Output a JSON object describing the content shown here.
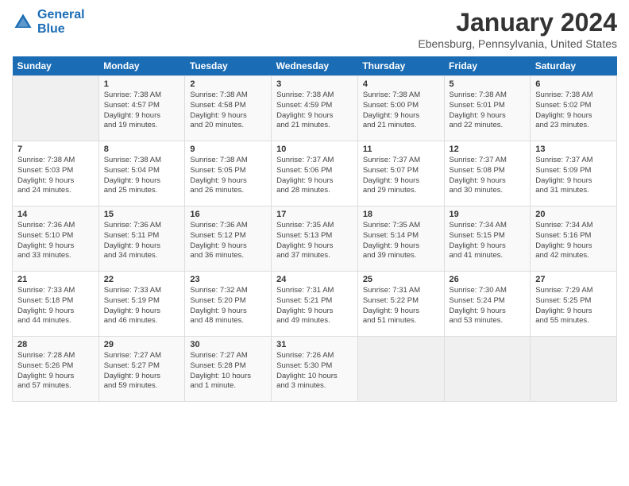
{
  "logo": {
    "line1": "General",
    "line2": "Blue"
  },
  "title": "January 2024",
  "location": "Ebensburg, Pennsylvania, United States",
  "headers": [
    "Sunday",
    "Monday",
    "Tuesday",
    "Wednesday",
    "Thursday",
    "Friday",
    "Saturday"
  ],
  "weeks": [
    [
      {
        "day": "",
        "info": ""
      },
      {
        "day": "1",
        "info": "Sunrise: 7:38 AM\nSunset: 4:57 PM\nDaylight: 9 hours\nand 19 minutes."
      },
      {
        "day": "2",
        "info": "Sunrise: 7:38 AM\nSunset: 4:58 PM\nDaylight: 9 hours\nand 20 minutes."
      },
      {
        "day": "3",
        "info": "Sunrise: 7:38 AM\nSunset: 4:59 PM\nDaylight: 9 hours\nand 21 minutes."
      },
      {
        "day": "4",
        "info": "Sunrise: 7:38 AM\nSunset: 5:00 PM\nDaylight: 9 hours\nand 21 minutes."
      },
      {
        "day": "5",
        "info": "Sunrise: 7:38 AM\nSunset: 5:01 PM\nDaylight: 9 hours\nand 22 minutes."
      },
      {
        "day": "6",
        "info": "Sunrise: 7:38 AM\nSunset: 5:02 PM\nDaylight: 9 hours\nand 23 minutes."
      }
    ],
    [
      {
        "day": "7",
        "info": "Sunrise: 7:38 AM\nSunset: 5:03 PM\nDaylight: 9 hours\nand 24 minutes."
      },
      {
        "day": "8",
        "info": "Sunrise: 7:38 AM\nSunset: 5:04 PM\nDaylight: 9 hours\nand 25 minutes."
      },
      {
        "day": "9",
        "info": "Sunrise: 7:38 AM\nSunset: 5:05 PM\nDaylight: 9 hours\nand 26 minutes."
      },
      {
        "day": "10",
        "info": "Sunrise: 7:37 AM\nSunset: 5:06 PM\nDaylight: 9 hours\nand 28 minutes."
      },
      {
        "day": "11",
        "info": "Sunrise: 7:37 AM\nSunset: 5:07 PM\nDaylight: 9 hours\nand 29 minutes."
      },
      {
        "day": "12",
        "info": "Sunrise: 7:37 AM\nSunset: 5:08 PM\nDaylight: 9 hours\nand 30 minutes."
      },
      {
        "day": "13",
        "info": "Sunrise: 7:37 AM\nSunset: 5:09 PM\nDaylight: 9 hours\nand 31 minutes."
      }
    ],
    [
      {
        "day": "14",
        "info": "Sunrise: 7:36 AM\nSunset: 5:10 PM\nDaylight: 9 hours\nand 33 minutes."
      },
      {
        "day": "15",
        "info": "Sunrise: 7:36 AM\nSunset: 5:11 PM\nDaylight: 9 hours\nand 34 minutes."
      },
      {
        "day": "16",
        "info": "Sunrise: 7:36 AM\nSunset: 5:12 PM\nDaylight: 9 hours\nand 36 minutes."
      },
      {
        "day": "17",
        "info": "Sunrise: 7:35 AM\nSunset: 5:13 PM\nDaylight: 9 hours\nand 37 minutes."
      },
      {
        "day": "18",
        "info": "Sunrise: 7:35 AM\nSunset: 5:14 PM\nDaylight: 9 hours\nand 39 minutes."
      },
      {
        "day": "19",
        "info": "Sunrise: 7:34 AM\nSunset: 5:15 PM\nDaylight: 9 hours\nand 41 minutes."
      },
      {
        "day": "20",
        "info": "Sunrise: 7:34 AM\nSunset: 5:16 PM\nDaylight: 9 hours\nand 42 minutes."
      }
    ],
    [
      {
        "day": "21",
        "info": "Sunrise: 7:33 AM\nSunset: 5:18 PM\nDaylight: 9 hours\nand 44 minutes."
      },
      {
        "day": "22",
        "info": "Sunrise: 7:33 AM\nSunset: 5:19 PM\nDaylight: 9 hours\nand 46 minutes."
      },
      {
        "day": "23",
        "info": "Sunrise: 7:32 AM\nSunset: 5:20 PM\nDaylight: 9 hours\nand 48 minutes."
      },
      {
        "day": "24",
        "info": "Sunrise: 7:31 AM\nSunset: 5:21 PM\nDaylight: 9 hours\nand 49 minutes."
      },
      {
        "day": "25",
        "info": "Sunrise: 7:31 AM\nSunset: 5:22 PM\nDaylight: 9 hours\nand 51 minutes."
      },
      {
        "day": "26",
        "info": "Sunrise: 7:30 AM\nSunset: 5:24 PM\nDaylight: 9 hours\nand 53 minutes."
      },
      {
        "day": "27",
        "info": "Sunrise: 7:29 AM\nSunset: 5:25 PM\nDaylight: 9 hours\nand 55 minutes."
      }
    ],
    [
      {
        "day": "28",
        "info": "Sunrise: 7:28 AM\nSunset: 5:26 PM\nDaylight: 9 hours\nand 57 minutes."
      },
      {
        "day": "29",
        "info": "Sunrise: 7:27 AM\nSunset: 5:27 PM\nDaylight: 9 hours\nand 59 minutes."
      },
      {
        "day": "30",
        "info": "Sunrise: 7:27 AM\nSunset: 5:28 PM\nDaylight: 10 hours\nand 1 minute."
      },
      {
        "day": "31",
        "info": "Sunrise: 7:26 AM\nSunset: 5:30 PM\nDaylight: 10 hours\nand 3 minutes."
      },
      {
        "day": "",
        "info": ""
      },
      {
        "day": "",
        "info": ""
      },
      {
        "day": "",
        "info": ""
      }
    ]
  ]
}
